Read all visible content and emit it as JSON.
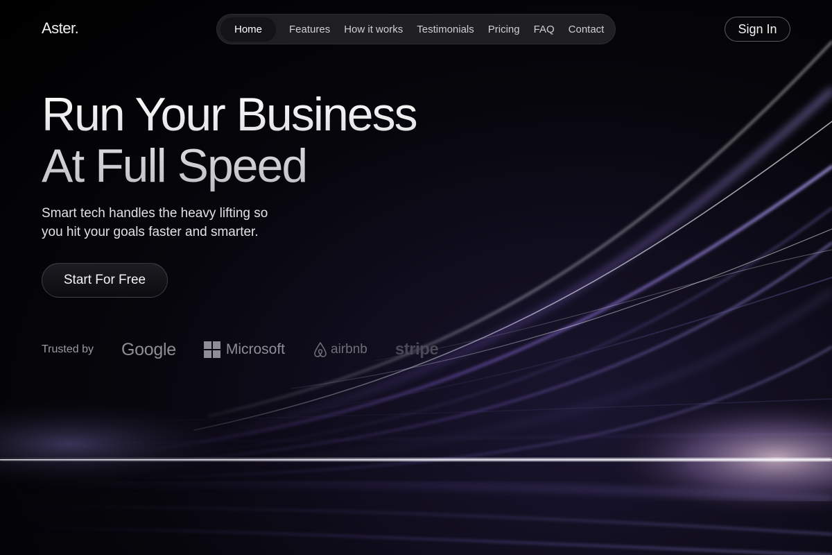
{
  "brand": {
    "name": "Aster."
  },
  "nav": {
    "items": [
      {
        "label": "Home",
        "active": true
      },
      {
        "label": "Features",
        "active": false
      },
      {
        "label": "How it works",
        "active": false
      },
      {
        "label": "Testimonials",
        "active": false
      },
      {
        "label": "Pricing",
        "active": false
      },
      {
        "label": "FAQ",
        "active": false
      },
      {
        "label": "Contact",
        "active": false
      }
    ]
  },
  "header": {
    "signin_label": "Sign In"
  },
  "hero": {
    "title_line1": "Run Your Business",
    "title_line2": "At Full Speed",
    "subtitle_line1": "Smart tech handles the heavy lifting so",
    "subtitle_line2": "you hit your goals faster and smarter.",
    "cta_label": "Start For Free"
  },
  "trusted": {
    "label": "Trusted by",
    "logos": [
      {
        "name": "Google",
        "icon": "google-logo"
      },
      {
        "name": "Microsoft",
        "icon": "microsoft-logo"
      },
      {
        "name": "airbnb",
        "icon": "airbnb-logo"
      },
      {
        "name": "stripe",
        "icon": "stripe-logo"
      }
    ]
  },
  "colors": {
    "background": "#000000",
    "accent_purple": "#8a6cd8",
    "accent_light": "#d8dcff",
    "text_muted": "#9a9aa2"
  }
}
